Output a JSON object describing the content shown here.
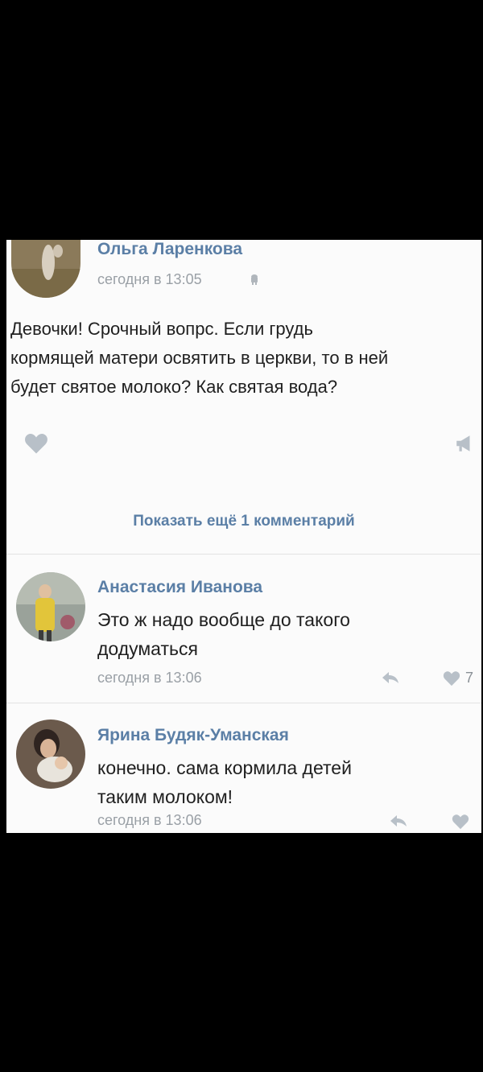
{
  "post": {
    "author": "Ольга Ларенкова",
    "time": "сегодня в 13:05",
    "text_lines": [
      "Девочки! Срочный вопрс. Если грудь",
      "кормящей матери освятить в церкви, то в ней",
      "будет святое молоко? Как святая вода?"
    ]
  },
  "show_more_label": "Показать ещё 1 комментарий",
  "comments": [
    {
      "author": "Анастасия Иванова",
      "text_lines": [
        "Это ж надо вообще до такого",
        "додуматься"
      ],
      "time": "сегодня в 13:06",
      "likes": "7"
    },
    {
      "author": "Ярина Будяк-Уманская",
      "text_lines": [
        "конечно. сама кормила детей",
        "таким молоком!"
      ],
      "time": "сегодня в 13:06",
      "likes": ""
    }
  ],
  "icons": {
    "post_like": "heart-icon",
    "post_share": "megaphone-icon",
    "reply": "reply-arrow-icon",
    "like": "heart-icon",
    "device": "android-icon"
  },
  "colors": {
    "background": "#000000",
    "card": "#fbfbfb",
    "link": "#5b7fa6",
    "muted": "#9aa0a6",
    "text": "#1f1f1f",
    "icon": "#b8c0c8"
  }
}
